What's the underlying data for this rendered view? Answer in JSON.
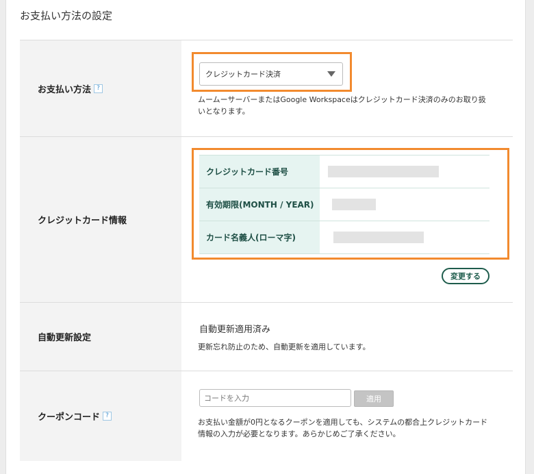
{
  "page": {
    "title": "お支払い方法の設定"
  },
  "payment_method": {
    "label": "お支払い方法",
    "help": "?",
    "selected": "クレジットカード決済",
    "note": "ムームーサーバーまたはGoogle Workspaceはクレジットカード決済のみのお取り扱いとなります。"
  },
  "credit_card": {
    "label": "クレジットカード情報",
    "fields": [
      {
        "label": "クレジットカード番号"
      },
      {
        "label": "有効期限(MONTH / YEAR)"
      },
      {
        "label": "カード名義人(ローマ字)"
      }
    ],
    "change_button": "変更する"
  },
  "auto_renew": {
    "label": "自動更新設定",
    "status": "自動更新適用済み",
    "note": "更新忘れ防止のため、自動更新を適用しています。"
  },
  "coupon": {
    "label": "クーポンコード",
    "help": "?",
    "placeholder": "コードを入力",
    "apply_button": "適用",
    "note": "お支払い金額が0円となるクーポンを適用しても、システムの都合上クレジットカード情報の入力が必要となります。あらかじめご了承ください。"
  },
  "colors": {
    "highlight": "#f28a2e",
    "accent": "#1e5c4c",
    "table_header_bg": "#e6f4f1"
  }
}
